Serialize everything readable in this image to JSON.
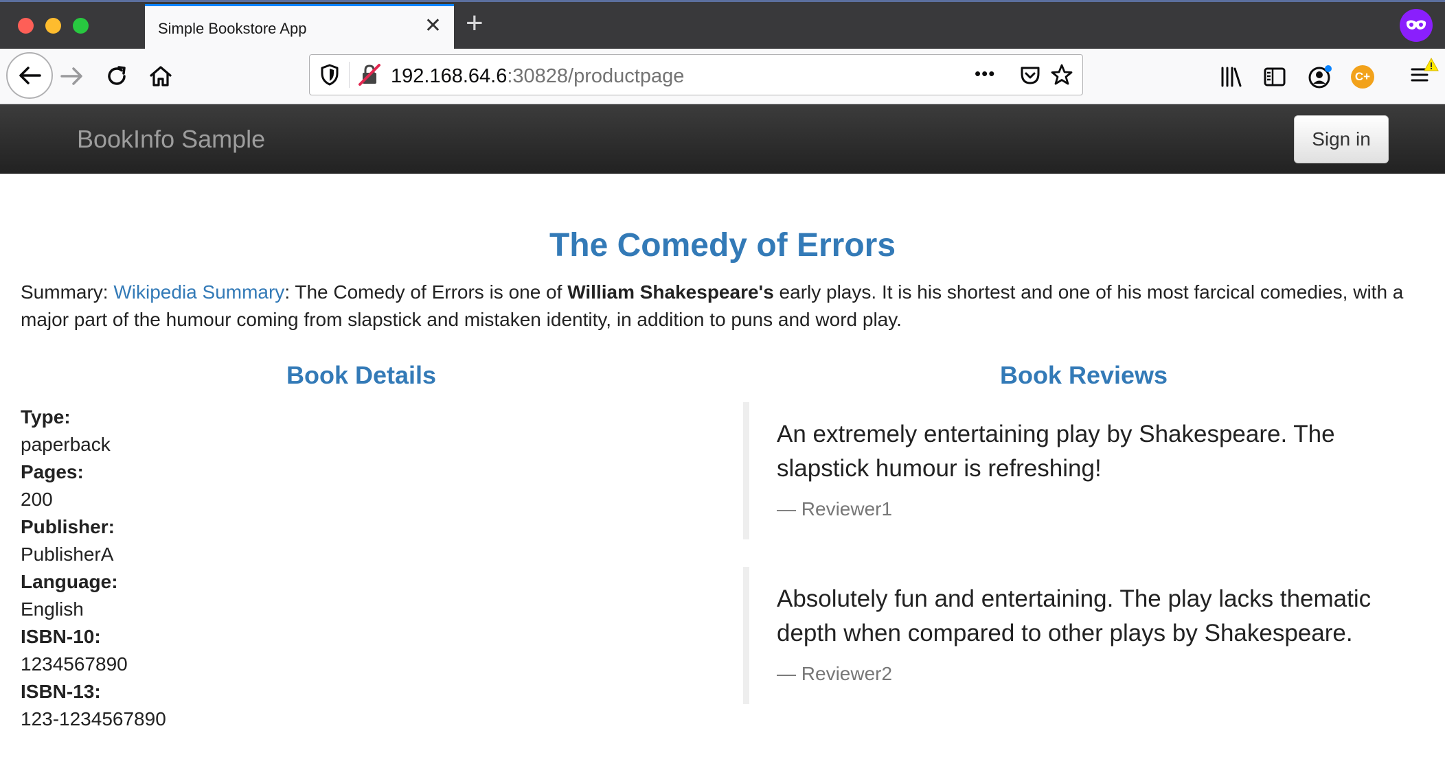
{
  "browser": {
    "tab_title": "Simple Bookstore App",
    "url_host": "192.168.64.6",
    "url_rest": ":30828/productpage",
    "url_more": "•••"
  },
  "navbar": {
    "brand": "BookInfo Sample",
    "signin_label": "Sign in"
  },
  "product": {
    "title": "The Comedy of Errors",
    "summary_prefix": "Summary: ",
    "summary_link": "Wikipedia Summary",
    "summary_mid": ": The Comedy of Errors is one of ",
    "summary_bold": "William Shakespeare's",
    "summary_rest": " early plays. It is his shortest and one of his most farcical comedies, with a major part of the humour coming from slapstick and mistaken identity, in addition to puns and word play."
  },
  "details": {
    "heading": "Book Details",
    "items": [
      {
        "label": "Type:",
        "value": "paperback"
      },
      {
        "label": "Pages:",
        "value": "200"
      },
      {
        "label": "Publisher:",
        "value": "PublisherA"
      },
      {
        "label": "Language:",
        "value": "English"
      },
      {
        "label": "ISBN-10:",
        "value": "1234567890"
      },
      {
        "label": "ISBN-13:",
        "value": "123-1234567890"
      }
    ]
  },
  "reviews": {
    "heading": "Book Reviews",
    "items": [
      {
        "text": "An extremely entertaining play by Shakespeare. The slapstick humour is refreshing!",
        "author": "— Reviewer1"
      },
      {
        "text": "Absolutely fun and entertaining. The play lacks thematic depth when compared to other plays by Shakespeare.",
        "author": "— Reviewer2"
      }
    ]
  },
  "colors": {
    "link": "#337ab7",
    "navbar": "#222222",
    "tab_accent": "#0a84ff",
    "private": "#8a1ffc"
  }
}
